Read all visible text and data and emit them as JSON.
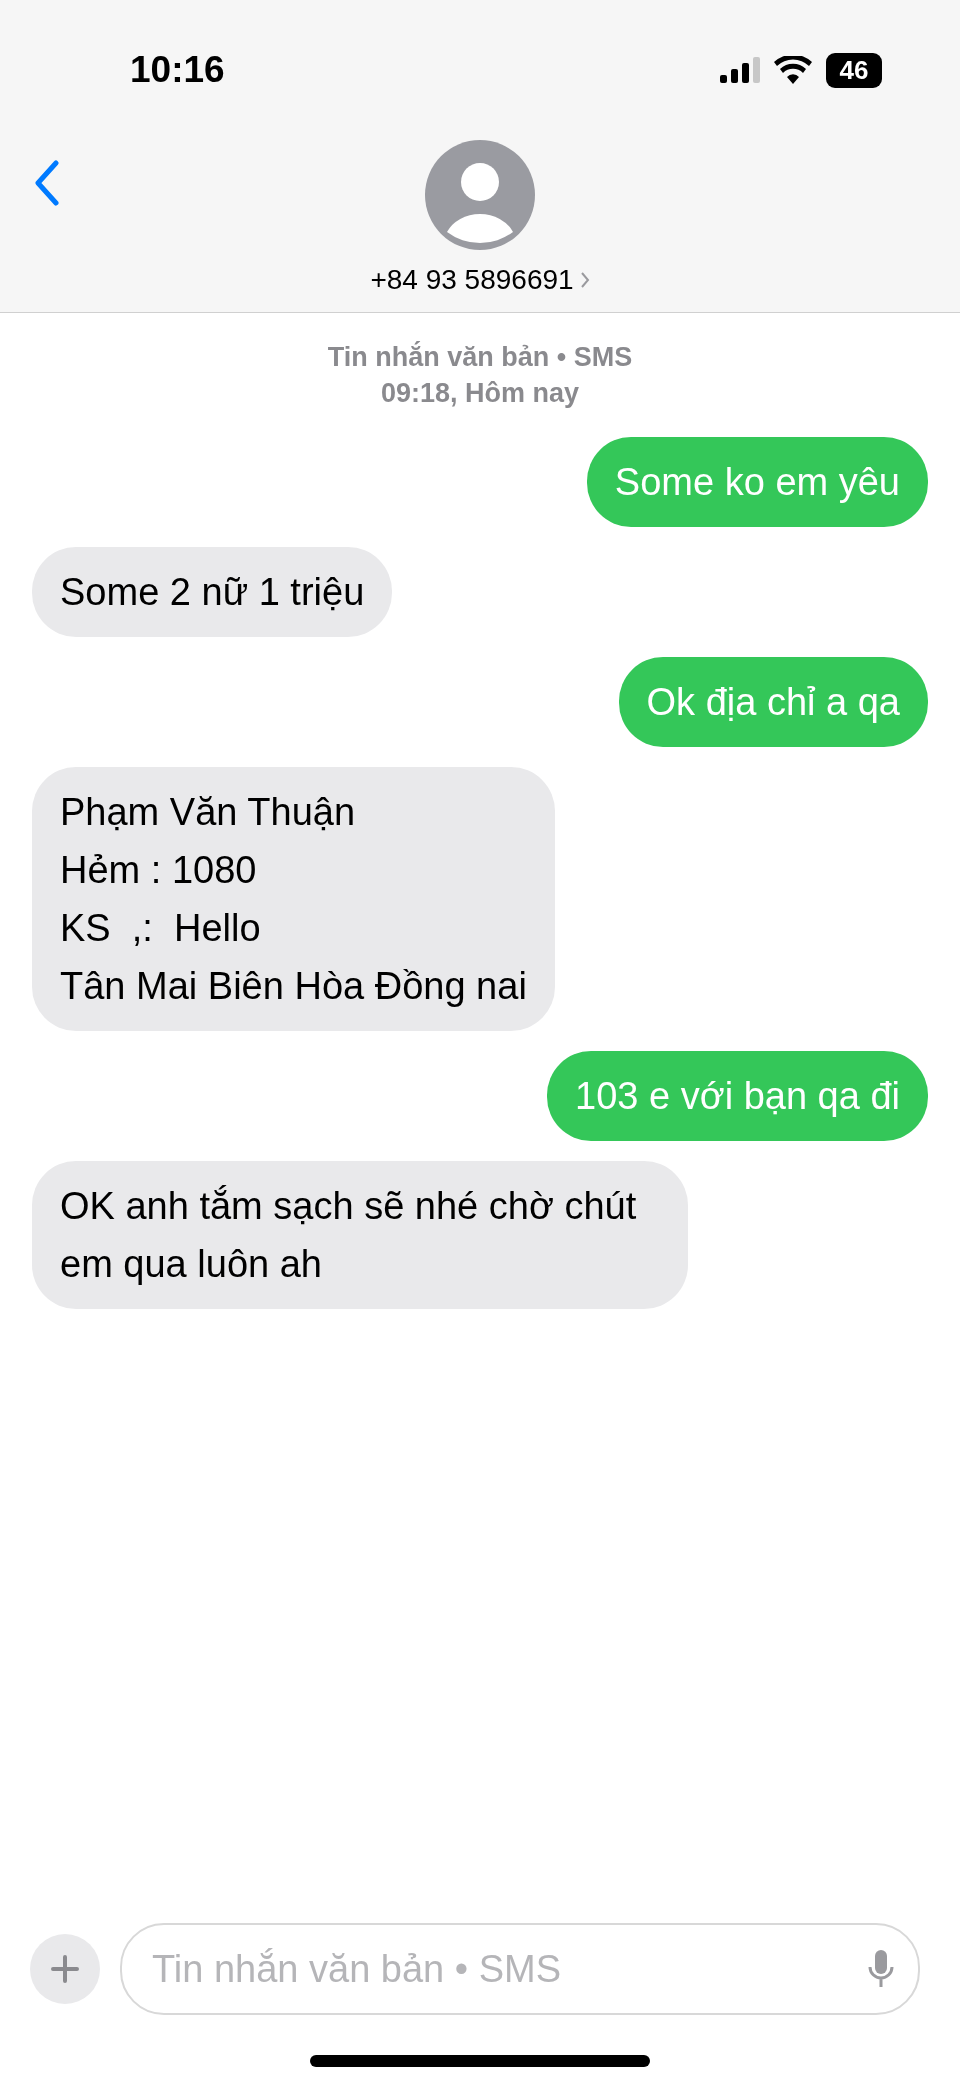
{
  "status_bar": {
    "time": "10:16",
    "battery": "46"
  },
  "header": {
    "contact": "+84 93 5896691"
  },
  "timestamp": {
    "service": "Tin nhắn văn bản • SMS",
    "time": "09:18, Hôm nay"
  },
  "messages": [
    {
      "kind": "sent",
      "text": "Some ko em yêu"
    },
    {
      "kind": "received",
      "text": "Some 2 nữ 1 triệu"
    },
    {
      "kind": "sent",
      "text": "Ok địa chỉ a qa"
    },
    {
      "kind": "received",
      "text": "Phạm Văn Thuận\nHẻm : 1080\nKS  ,:  Hello\nTân Mai Biên Hòa Đồng nai"
    },
    {
      "kind": "sent",
      "text": "103 e với bạn qa đi"
    },
    {
      "kind": "received",
      "text": "OK anh tắm sạch sẽ nhé chờ chút em qua luôn ah"
    }
  ],
  "composer": {
    "placeholder": "Tin nhắn văn bản • SMS"
  }
}
